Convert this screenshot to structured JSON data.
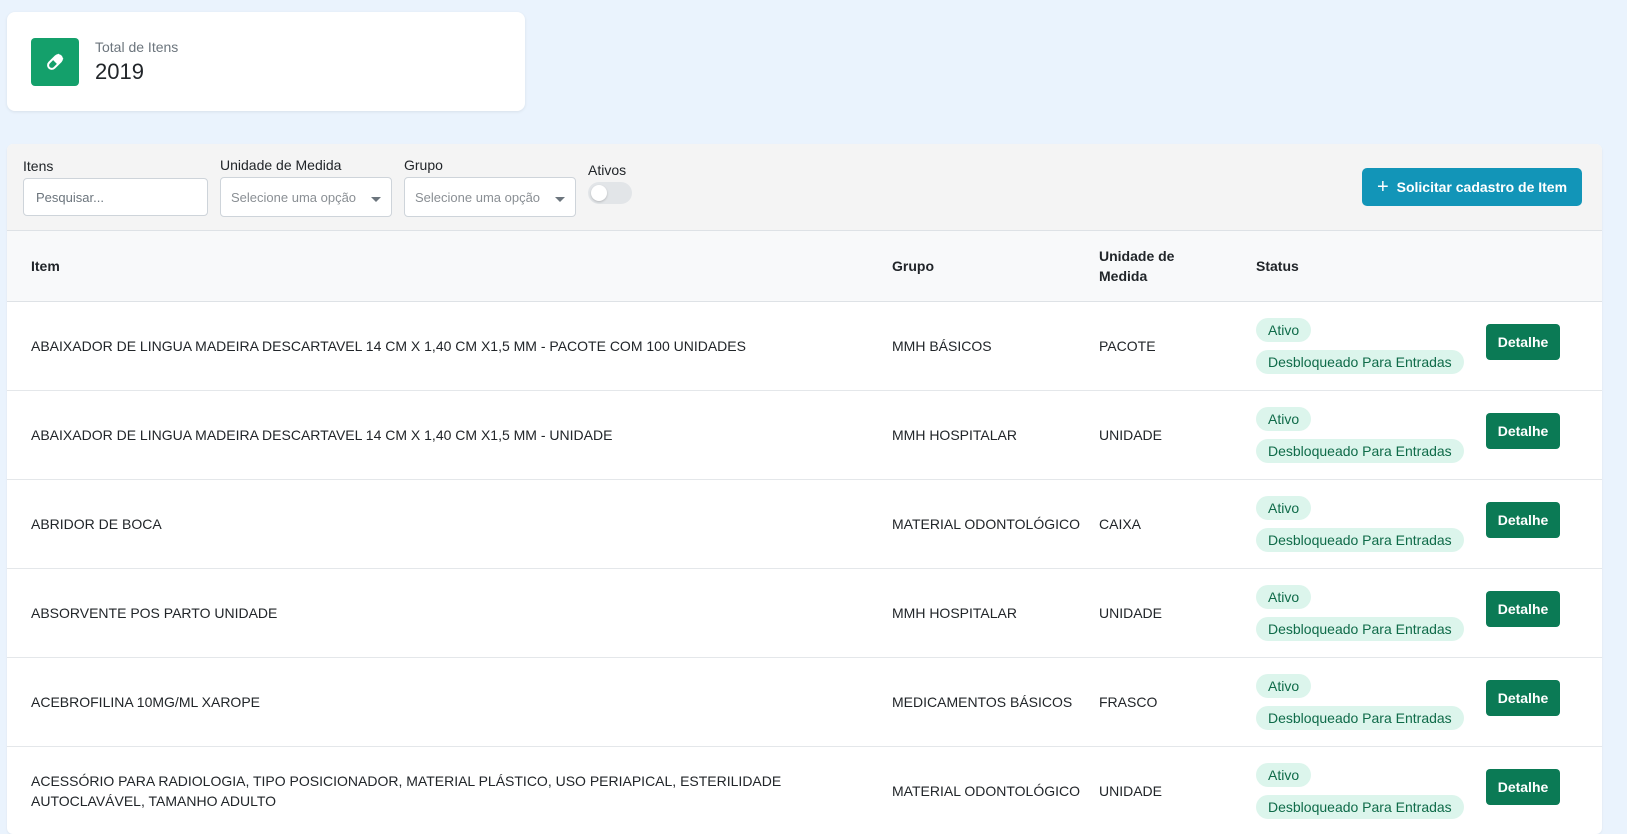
{
  "summary": {
    "label": "Total de Itens",
    "value": "2019",
    "icon": "pill-icon",
    "icon_color": "#14a06b"
  },
  "filters": {
    "itens_label": "Itens",
    "search_placeholder": "Pesquisar...",
    "unidade_label": "Unidade de Medida",
    "unidade_placeholder": "Selecione uma opção",
    "grupo_label": "Grupo",
    "grupo_placeholder": "Selecione uma opção",
    "ativos_label": "Ativos",
    "ativos_on": false,
    "add_button": "Solicitar cadastro de Item",
    "add_button_color": "#1295b8"
  },
  "table": {
    "headers": {
      "item": "Item",
      "grupo": "Grupo",
      "unidade": "Unidade de Medida",
      "status": "Status"
    },
    "detail_label": "Detalhe",
    "rows": [
      {
        "item": "ABAIXADOR DE LINGUA MADEIRA DESCARTAVEL 14 CM X 1,40 CM X1,5 MM - PACOTE COM 100 UNIDADES",
        "grupo": "MMH BÁSICOS",
        "unidade": "PACOTE",
        "status1": "Ativo",
        "status2": "Desbloqueado Para Entradas"
      },
      {
        "item": "ABAIXADOR DE LINGUA MADEIRA DESCARTAVEL 14 CM X 1,40 CM X1,5 MM - UNIDADE",
        "grupo": "MMH HOSPITALAR",
        "unidade": "UNIDADE",
        "status1": "Ativo",
        "status2": "Desbloqueado Para Entradas"
      },
      {
        "item": "ABRIDOR DE BOCA",
        "grupo": "MATERIAL ODONTOLÓGICO",
        "unidade": "CAIXA",
        "status1": "Ativo",
        "status2": "Desbloqueado Para Entradas"
      },
      {
        "item": "ABSORVENTE POS PARTO UNIDADE",
        "grupo": "MMH HOSPITALAR",
        "unidade": "UNIDADE",
        "status1": "Ativo",
        "status2": "Desbloqueado Para Entradas"
      },
      {
        "item": "ACEBROFILINA 10MG/ML XAROPE",
        "grupo": "MEDICAMENTOS BÁSICOS",
        "unidade": "FRASCO",
        "status1": "Ativo",
        "status2": "Desbloqueado Para Entradas"
      },
      {
        "item": "ACESSÓRIO PARA RADIOLOGIA, TIPO POSICIONADOR, MATERIAL PLÁSTICO, USO PERIAPICAL, ESTERILIDADE AUTOCLAVÁVEL, TAMANHO ADULTO",
        "grupo": "MATERIAL ODONTOLÓGICO",
        "unidade": "UNIDADE",
        "status1": "Ativo",
        "status2": "Desbloqueado Para Entradas"
      }
    ]
  },
  "colors": {
    "page_bg": "#eaf3fd",
    "badge_bg": "#dcf5ec",
    "badge_text": "#0f6b49",
    "detail_button": "#0b7a55"
  }
}
